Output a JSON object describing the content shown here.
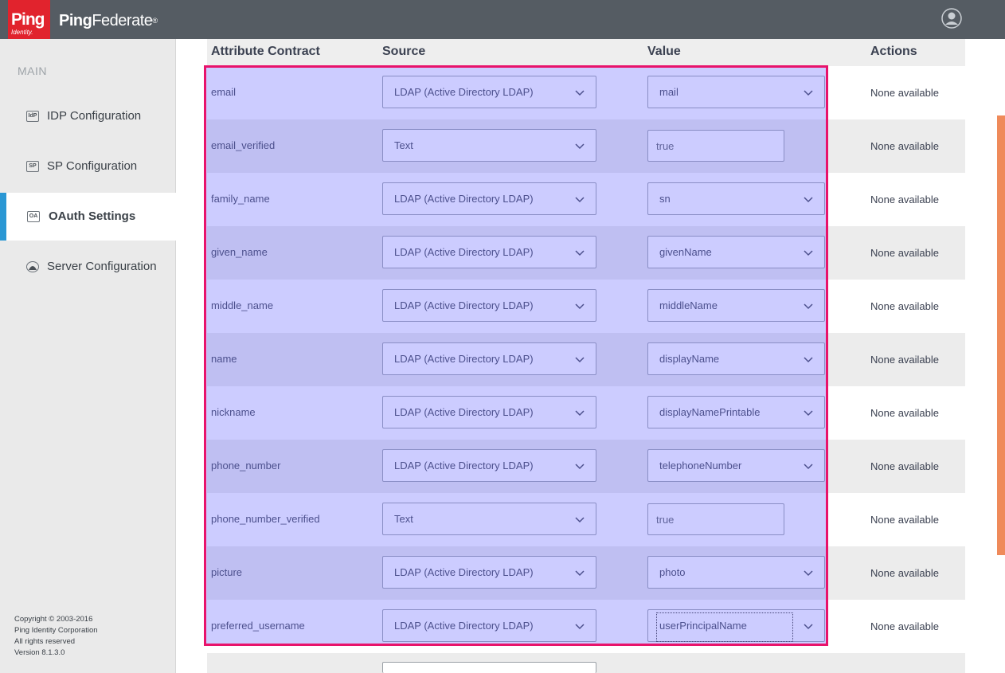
{
  "header": {
    "logo_text": "Ping",
    "logo_subtext": "Identity.",
    "product_bold": "Ping",
    "product_rest": "Federate",
    "product_mark": "®"
  },
  "sidebar": {
    "section_label": "MAIN",
    "items": [
      {
        "icon": "IdP",
        "label": "IDP Configuration",
        "active": false
      },
      {
        "icon": "SP",
        "label": "SP Configuration",
        "active": false
      },
      {
        "icon": "OA",
        "label": "OAuth Settings",
        "active": true
      },
      {
        "icon": "server-icon",
        "label": "Server Configuration",
        "active": false
      }
    ],
    "copyright": {
      "line1": "Copyright © 2003-2016",
      "line2": "Ping Identity Corporation",
      "line3": "All rights reserved",
      "line4": "Version 8.1.3.0"
    }
  },
  "table": {
    "columns": [
      "Attribute Contract",
      "Source",
      "Value",
      "Actions"
    ],
    "rows": [
      {
        "name": "email",
        "source": "LDAP (Active Directory LDAP)",
        "value": "mail",
        "value_type": "select",
        "action": "None available"
      },
      {
        "name": "email_verified",
        "source": "Text",
        "value": "true",
        "value_type": "text",
        "action": "None available"
      },
      {
        "name": "family_name",
        "source": "LDAP (Active Directory LDAP)",
        "value": "sn",
        "value_type": "select",
        "action": "None available"
      },
      {
        "name": "given_name",
        "source": "LDAP (Active Directory LDAP)",
        "value": "givenName",
        "value_type": "select",
        "action": "None available"
      },
      {
        "name": "middle_name",
        "source": "LDAP (Active Directory LDAP)",
        "value": "middleName",
        "value_type": "select",
        "action": "None available"
      },
      {
        "name": "name",
        "source": "LDAP (Active Directory LDAP)",
        "value": "displayName",
        "value_type": "select",
        "action": "None available"
      },
      {
        "name": "nickname",
        "source": "LDAP (Active Directory LDAP)",
        "value": "displayNamePrintable",
        "value_type": "select",
        "action": "None available"
      },
      {
        "name": "phone_number",
        "source": "LDAP (Active Directory LDAP)",
        "value": "telephoneNumber",
        "value_type": "select",
        "action": "None available"
      },
      {
        "name": "phone_number_verified",
        "source": "Text",
        "value": "true",
        "value_type": "text",
        "action": "None available"
      },
      {
        "name": "picture",
        "source": "LDAP (Active Directory LDAP)",
        "value": "photo",
        "value_type": "select",
        "action": "None available"
      },
      {
        "name": "preferred_username",
        "source": "LDAP (Active Directory LDAP)",
        "value": "userPrincipalName",
        "value_type": "select",
        "action": "None available"
      }
    ]
  },
  "colors": {
    "header_bg": "#555c63",
    "brand_red": "#e1232d",
    "active_accent": "#2a97d4",
    "highlight_border": "#e8136b",
    "scroll_thumb": "#ef8a5a"
  }
}
